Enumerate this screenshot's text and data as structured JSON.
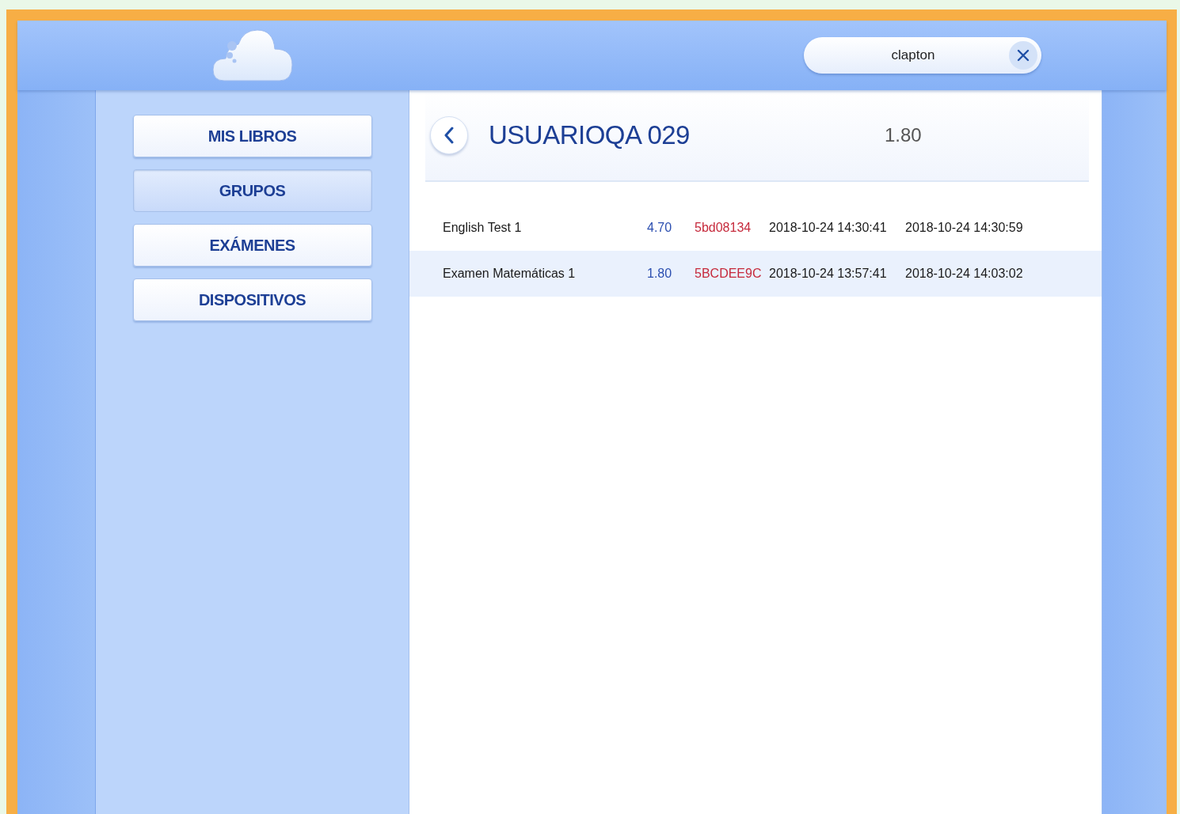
{
  "search": {
    "value": "clapton"
  },
  "sidebar": {
    "items": [
      {
        "label": "MIS LIBROS",
        "selected": false
      },
      {
        "label": "GRUPOS",
        "selected": true
      },
      {
        "label": "EXÁMENES",
        "selected": false
      },
      {
        "label": "DISPOSITIVOS",
        "selected": false
      }
    ]
  },
  "user": {
    "name": "USUARIOQA 029",
    "score": "1.80"
  },
  "exams": [
    {
      "name": "English Test 1",
      "score": "4.70",
      "code": "5bd08134",
      "start": "2018-10-24 14:30:41",
      "end": "2018-10-24 14:30:59",
      "selected": false
    },
    {
      "name": "Examen Matemáticas 1",
      "score": "1.80",
      "code": "5BCDEE9C",
      "start": "2018-10-24 13:57:41",
      "end": "2018-10-24 14:03:02",
      "selected": true
    }
  ]
}
